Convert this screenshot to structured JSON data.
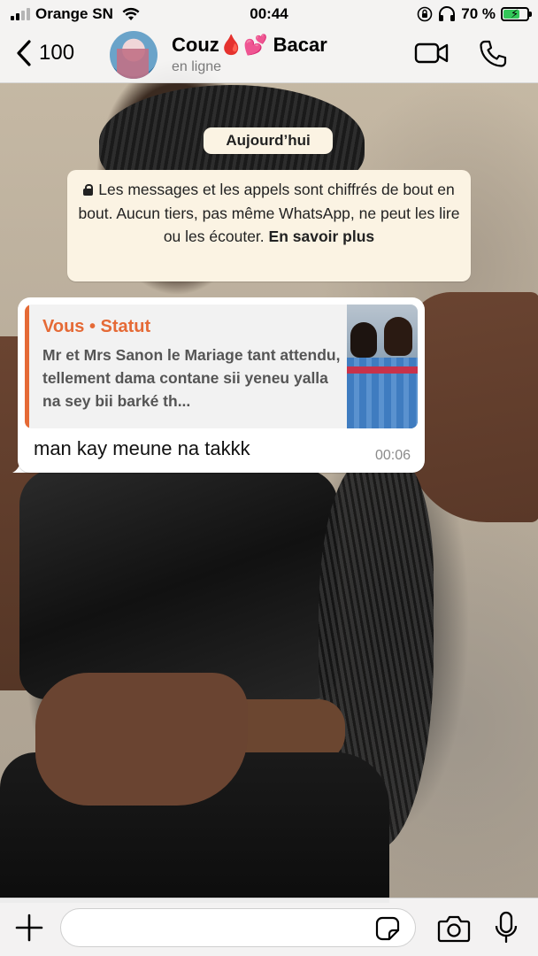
{
  "status_bar": {
    "carrier": "Orange SN",
    "time": "00:44",
    "battery_percent": "70 %",
    "battery_level": 0.7,
    "signal_bars_filled": 2,
    "signal_bars_total": 4
  },
  "header": {
    "back_count": "100",
    "contact_name": "Couz🩸💕 Bacar",
    "contact_status": "en ligne"
  },
  "chat": {
    "date_label": "Aujourd’hui",
    "e2e_notice": {
      "text": "Les messages et les appels sont chiffrés de bout en bout. Aucun tiers, pas même WhatsApp, ne peut les lire ou les écouter.",
      "link": "En savoir plus"
    },
    "messages": [
      {
        "quote_author": "Vous • Statut",
        "quote_text": "Mr et Mrs Sanon le Mariage tant attendu, tellement dama contane sii yeneu yalla na sey bii barké th...",
        "text": "man kay meune na takkk",
        "time": "00:06"
      }
    ]
  },
  "input_bar": {
    "placeholder": ""
  },
  "colors": {
    "quote_accent": "#e56a36",
    "system_bubble": "#fbf3e3",
    "battery_fill": "#33c759"
  },
  "icons": {
    "back": "chevron-left-icon",
    "video": "video-camera-icon",
    "call": "phone-icon",
    "plus": "plus-icon",
    "sticker": "sticker-icon",
    "camera": "camera-icon",
    "mic": "microphone-icon",
    "lock": "lock-icon"
  }
}
